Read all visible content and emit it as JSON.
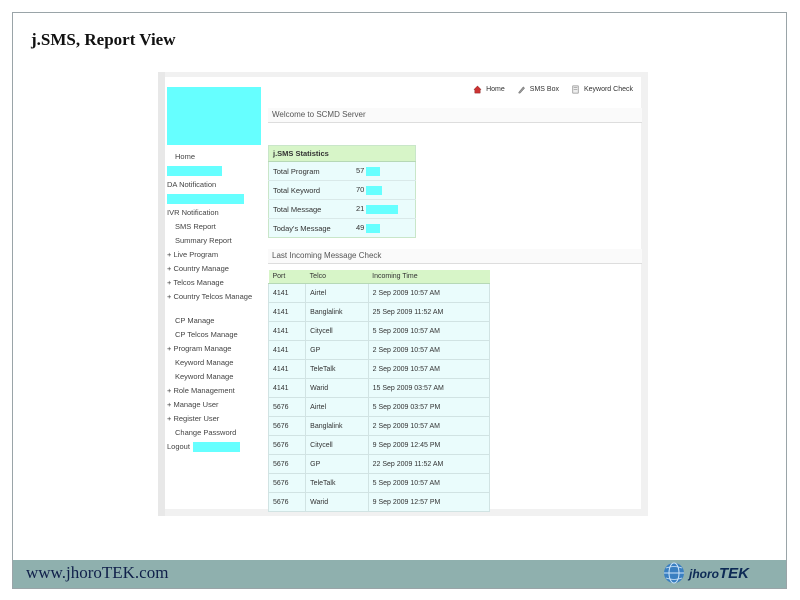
{
  "slide": {
    "title": "j.SMS, Report View",
    "footer_url": "www.jhoroTEK.com",
    "logo_text_prefix": "jhoro",
    "logo_text_suffix": "TEK"
  },
  "topnav": [
    {
      "label": "Home",
      "icon": "home-icon"
    },
    {
      "label": "SMS Box",
      "icon": "pen-icon"
    },
    {
      "label": "Keyword Check",
      "icon": "document-icon"
    }
  ],
  "menu": [
    {
      "label": "Home",
      "style": "indent"
    },
    {
      "label": "",
      "style": "mask",
      "mask_width": 55
    },
    {
      "label": "DA Notification",
      "style": "plain"
    },
    {
      "label": "",
      "style": "mask",
      "mask_width": 77
    },
    {
      "label": "IVR Notification",
      "style": "plain"
    },
    {
      "label": "SMS Report",
      "style": "indent"
    },
    {
      "label": "Summary Report",
      "style": "indent"
    },
    {
      "label": "+ Live Program",
      "style": "plain"
    },
    {
      "label": "+ Country Manage",
      "style": "plain"
    },
    {
      "label": "+ Telcos Manage",
      "style": "plain"
    },
    {
      "label": "+ Country Telcos Manage",
      "style": "wrap"
    },
    {
      "label": "CP Manage",
      "style": "indent"
    },
    {
      "label": "CP Telcos Manage",
      "style": "indent"
    },
    {
      "label": "+ Program Manage",
      "style": "plain"
    },
    {
      "label": "Keyword Manage",
      "style": "indent"
    },
    {
      "label": "Keyword Manage",
      "style": "indent"
    },
    {
      "label": "+ Role Management",
      "style": "plain"
    },
    {
      "label": "+ Manage User",
      "style": "plain"
    },
    {
      "label": "+ Register User",
      "style": "plain"
    },
    {
      "label": "Change Password",
      "style": "indent"
    },
    {
      "label": "Logout",
      "style": "logout",
      "mask_width": 47
    }
  ],
  "welcome_text": "Welcome to SCMD Server",
  "stats": {
    "header": "j.SMS Statistics",
    "rows": [
      {
        "label": "Total Program",
        "value": "57",
        "bar": 14
      },
      {
        "label": "Total Keyword",
        "value": "70",
        "bar": 16
      },
      {
        "label": "Total Message",
        "value": "21",
        "bar": 32
      },
      {
        "label": "Today's Message",
        "value": "49",
        "bar": 14
      }
    ]
  },
  "last_incoming_text": "Last Incoming Message Check",
  "messages": {
    "headers": [
      "Port",
      "Telco",
      "Incoming Time"
    ],
    "rows": [
      [
        "4141",
        "Airtel",
        "2 Sep 2009 10:57 AM"
      ],
      [
        "4141",
        "Banglalink",
        "25 Sep 2009 11:52 AM"
      ],
      [
        "4141",
        "Citycell",
        "5 Sep 2009 10:57 AM"
      ],
      [
        "4141",
        "GP",
        "2 Sep 2009 10:57 AM"
      ],
      [
        "4141",
        "TeleTalk",
        "2 Sep 2009 10:57 AM"
      ],
      [
        "4141",
        "Warid",
        "15 Sep 2009 03:57 AM"
      ],
      [
        "5676",
        "Airtel",
        "5 Sep 2009 03:57 PM"
      ],
      [
        "5676",
        "Banglalink",
        "2 Sep 2009 10:57 AM"
      ],
      [
        "5676",
        "Citycell",
        "9 Sep 2009 12:45 PM"
      ],
      [
        "5676",
        "GP",
        "22 Sep 2009 11:52 AM"
      ],
      [
        "5676",
        "TeleTalk",
        "5 Sep 2009 10:57 AM"
      ],
      [
        "5676",
        "Warid",
        "9 Sep 2009 12:57 PM"
      ]
    ]
  },
  "colors": {
    "mask": "#66ffff",
    "footer_band": "#8fb0ae",
    "table_header": "#d7f5c8",
    "table_cell": "#eafcfc"
  }
}
